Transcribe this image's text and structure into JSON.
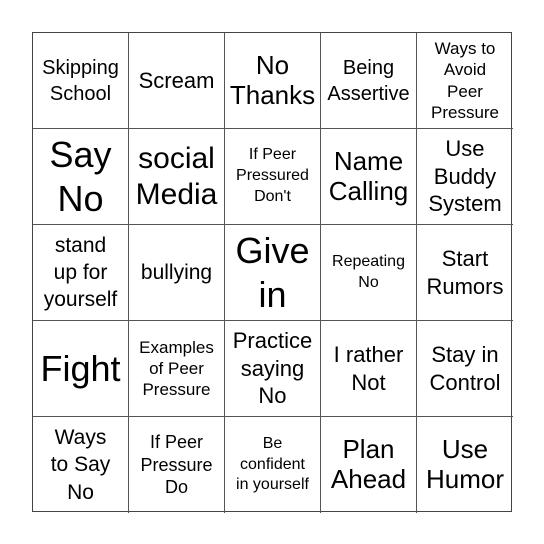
{
  "board": {
    "cells": [
      [
        "Skipping",
        "School"
      ],
      [
        "Scream"
      ],
      [
        "No",
        "Thanks"
      ],
      [
        "Being",
        "Assertive"
      ],
      [
        "Ways to",
        "Avoid",
        "Peer",
        "Pressure"
      ],
      [
        "Say",
        "No"
      ],
      [
        "social",
        "Media"
      ],
      [
        "If Peer",
        "Pressured",
        "Don't"
      ],
      [
        "Name",
        "Calling"
      ],
      [
        "Use",
        "Buddy",
        "System"
      ],
      [
        "stand",
        "up for",
        "yourself"
      ],
      [
        "bullying"
      ],
      [
        "Give",
        "in"
      ],
      [
        "Repeating",
        "No"
      ],
      [
        "Start",
        "Rumors"
      ],
      [
        "Fight"
      ],
      [
        "Examples",
        "of Peer",
        "Pressure"
      ],
      [
        "Practice",
        "saying",
        "No"
      ],
      [
        "I rather",
        "Not"
      ],
      [
        "Stay in",
        "Control"
      ],
      [
        "Ways",
        "to Say",
        "No"
      ],
      [
        "If Peer",
        "Pressure",
        "Do"
      ],
      [
        "Be",
        "confident",
        "in yourself"
      ],
      [
        "Plan",
        "Ahead"
      ],
      [
        "Use",
        "Humor"
      ]
    ]
  }
}
